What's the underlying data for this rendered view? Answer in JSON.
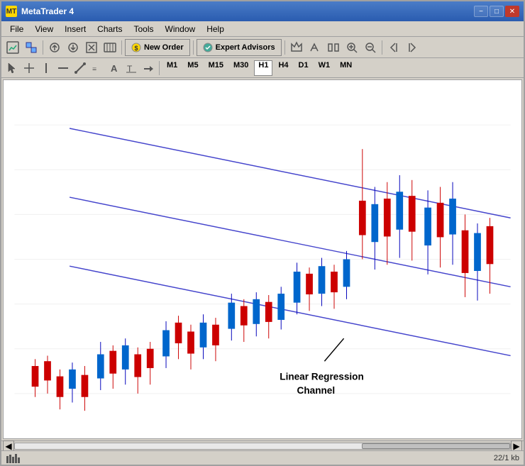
{
  "titleBar": {
    "icon": "MT",
    "title": "MetaTrader 4",
    "minimizeLabel": "−",
    "maximizeLabel": "□",
    "closeLabel": "✕"
  },
  "menuBar": {
    "items": [
      "File",
      "View",
      "Insert",
      "Charts",
      "Tools",
      "Window",
      "Help"
    ]
  },
  "toolbar1": {
    "newOrderLabel": "New Order",
    "expertAdvisorsLabel": "Expert Advisors"
  },
  "toolbar2": {
    "timeframes": [
      "M1",
      "M5",
      "M15",
      "M30",
      "H1",
      "H4",
      "D1",
      "W1",
      "MN"
    ]
  },
  "chart": {
    "annotation": "Linear Regression\nChannel"
  },
  "statusBar": {
    "rightText": "22/1 kb"
  }
}
